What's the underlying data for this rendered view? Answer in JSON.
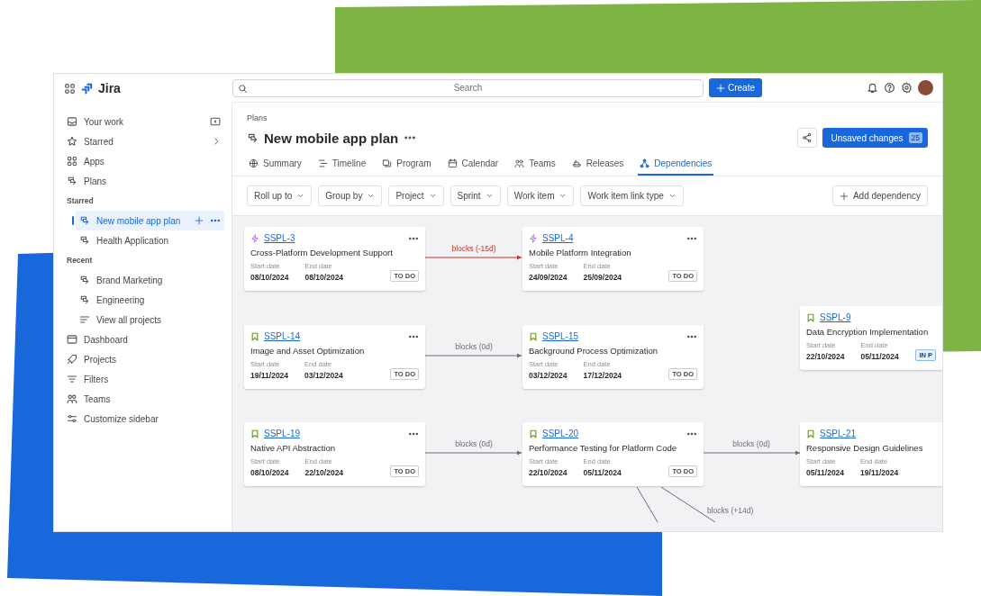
{
  "topbar": {
    "product": "Jira",
    "search": {
      "placeholder": "Search"
    },
    "create_button": "Create"
  },
  "sidebar": {
    "items": [
      {
        "label": "Your work",
        "selected": false
      },
      {
        "label": "Starred",
        "selected": false
      },
      {
        "label": "Apps",
        "selected": false
      },
      {
        "label": "Plans",
        "selected": false,
        "children": [
          {
            "kind": "heading",
            "label": "Starred"
          },
          {
            "kind": "plan",
            "label": "New mobile app plan",
            "selected": true
          },
          {
            "kind": "plan",
            "label": "Health Application",
            "selected": false
          },
          {
            "kind": "heading",
            "label": "Recent"
          },
          {
            "kind": "plan",
            "label": "Brand Marketing",
            "selected": false
          },
          {
            "kind": "plan",
            "label": "Engineering",
            "selected": false
          },
          {
            "kind": "list",
            "label": "View all projects",
            "selected": false
          }
        ]
      },
      {
        "label": "Dashboard",
        "selected": false
      },
      {
        "label": "Projects",
        "selected": false
      },
      {
        "label": "Filters",
        "selected": false
      },
      {
        "label": "Teams",
        "selected": false
      },
      {
        "label": "Customize sidebar",
        "selected": false
      }
    ]
  },
  "header": {
    "breadcrumb": "Plans",
    "title": "New mobile app plan",
    "unsaved_button": "Unsaved changes",
    "unsaved_count": "25"
  },
  "tabs": [
    {
      "label": "Summary",
      "selected": false
    },
    {
      "label": "Timeline",
      "selected": false
    },
    {
      "label": "Program",
      "selected": false
    },
    {
      "label": "Calendar",
      "selected": false
    },
    {
      "label": "Teams",
      "selected": false
    },
    {
      "label": "Releases",
      "selected": false
    },
    {
      "label": "Dependencies",
      "selected": true
    }
  ],
  "filters": [
    "Roll up to",
    "Group by",
    "Project",
    "Sprint",
    "Work item",
    "Work item link type"
  ],
  "add_dependency": "Add dependency",
  "cards": [
    {
      "kind": "epic",
      "key": "SSPL-3",
      "title": "Cross-Platform Development Support",
      "start_label": "Start date",
      "start": "08/10/2024",
      "end_label": "End date",
      "end": "08/10/2024",
      "status": {
        "label": "TO DO",
        "kind": "todo"
      }
    },
    {
      "kind": "epic",
      "key": "SSPL-4",
      "title": "Mobile Platform Integration",
      "start_label": "Start date",
      "start": "24/09/2024",
      "end_label": "End date",
      "end": "25/09/2024",
      "status": {
        "label": "TO DO",
        "kind": "todo"
      }
    },
    {
      "kind": "story",
      "key": "SSPL-9",
      "title": "Data Encryption Implementation",
      "start_label": "Start date",
      "start": "22/10/2024",
      "end_label": "End date",
      "end": "05/11/2024",
      "status": {
        "label": "IN P",
        "kind": "in_progress"
      }
    },
    {
      "kind": "story",
      "key": "SSPL-14",
      "title": "Image and Asset Optimization",
      "start_label": "Start date",
      "start": "19/11/2024",
      "end_label": "End date",
      "end": "03/12/2024",
      "status": {
        "label": "TO DO",
        "kind": "todo"
      }
    },
    {
      "kind": "story",
      "key": "SSPL-15",
      "title": "Background Process Optimization",
      "start_label": "Start date",
      "start": "03/12/2024",
      "end_label": "End date",
      "end": "17/12/2024",
      "status": {
        "label": "TO DO",
        "kind": "todo"
      }
    },
    {
      "kind": "story",
      "key": "SSPL-19",
      "title": "Native API Abstraction",
      "start_label": "Start date",
      "start": "08/10/2024",
      "end_label": "End date",
      "end": "22/10/2024",
      "status": {
        "label": "TO DO",
        "kind": "todo"
      }
    },
    {
      "kind": "story",
      "key": "SSPL-20",
      "title": "Performance Testing for Platform Code",
      "start_label": "Start date",
      "start": "22/10/2024",
      "end_label": "End date",
      "end": "05/11/2024",
      "status": {
        "label": "TO DO",
        "kind": "todo"
      }
    },
    {
      "kind": "story",
      "key": "SSPL-21",
      "title": "Responsive Design Guidelines",
      "start_label": "Start date",
      "start": "05/11/2024",
      "end_label": "End date",
      "end": "19/11/2024"
    }
  ],
  "links": [
    {
      "label": "blocks (-15d)",
      "kind": "negative"
    },
    {
      "label": "blocks (0d)",
      "kind": "normal"
    },
    {
      "label": "blocks (0d)",
      "kind": "normal"
    },
    {
      "label": "blocks (0d)",
      "kind": "normal"
    },
    {
      "label": "blocks (+14d)",
      "kind": "normal"
    }
  ]
}
